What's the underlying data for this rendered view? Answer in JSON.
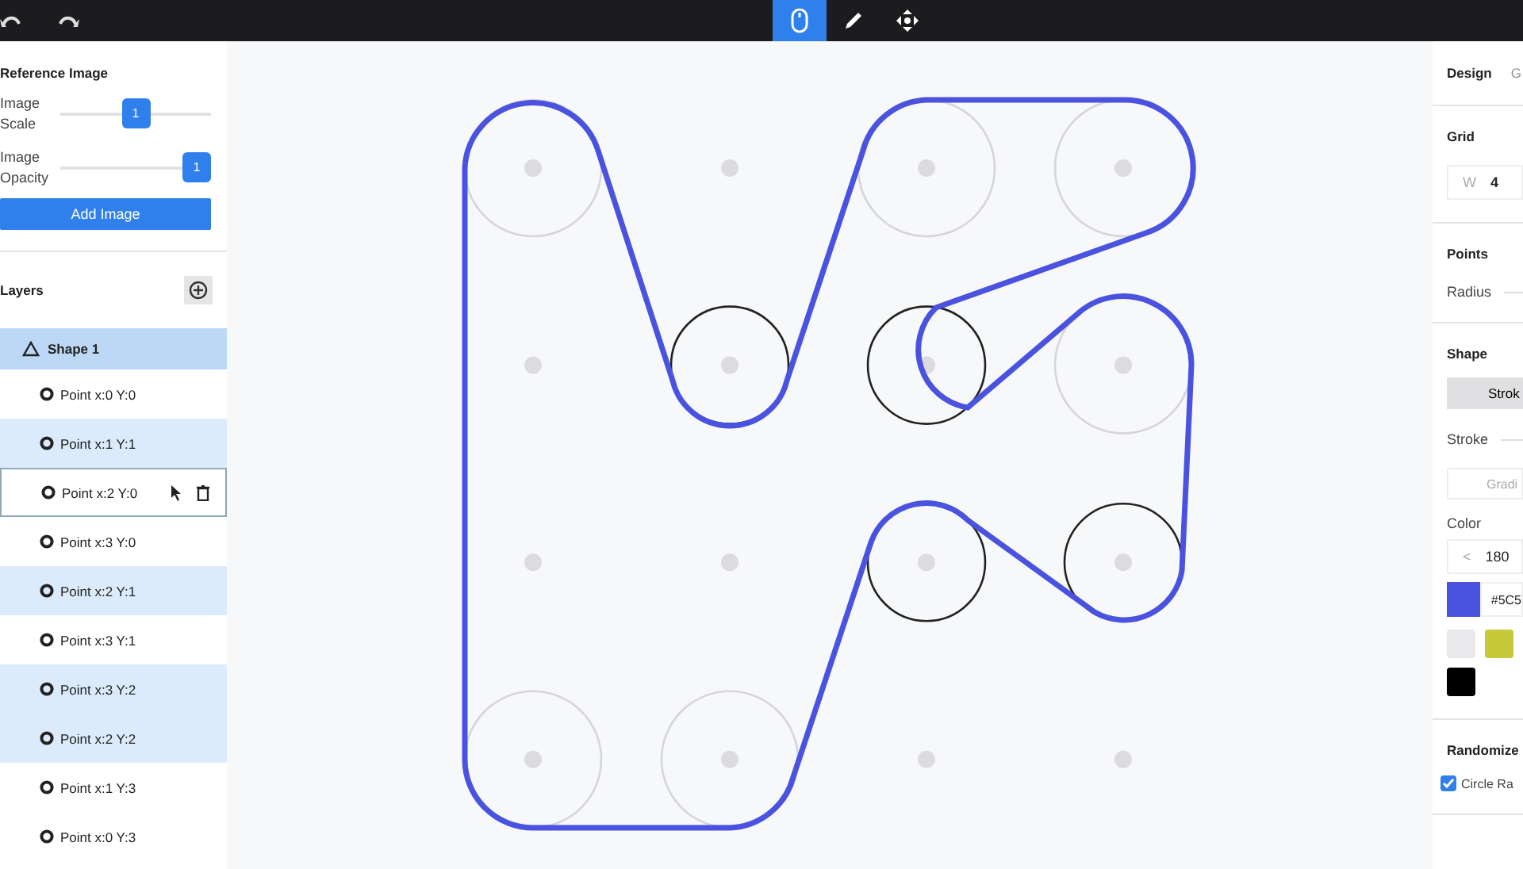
{
  "toolbar": {
    "tools": [
      {
        "kind": "mouse",
        "selected": true
      },
      {
        "kind": "pencil",
        "selected": false
      },
      {
        "kind": "move",
        "selected": false
      }
    ]
  },
  "reference_image": {
    "title": "Reference Image",
    "sliders": [
      {
        "label": "Image Scale",
        "value": "1",
        "level": 0.5
      },
      {
        "label": "Image Opacity",
        "value": "1",
        "level": 1
      }
    ],
    "button": "Add Image"
  },
  "layers": {
    "title": "Layers",
    "shape": {
      "label": "Shape 1",
      "selected": true,
      "children": [
        {
          "label": "Point x:0 Y:0",
          "selected": false,
          "hovered": false
        },
        {
          "label": "Point x:1 Y:1",
          "selected": true,
          "hovered": false
        },
        {
          "label": "Point x:2 Y:0",
          "selected": false,
          "hovered": true
        },
        {
          "label": "Point x:3 Y:0",
          "selected": false,
          "hovered": false
        },
        {
          "label": "Point x:2 Y:1",
          "selected": true,
          "hovered": false
        },
        {
          "label": "Point x:3 Y:1",
          "selected": false,
          "hovered": false
        },
        {
          "label": "Point x:3 Y:2",
          "selected": true,
          "hovered": false
        },
        {
          "label": "Point x:2 Y:2",
          "selected": true,
          "hovered": false
        },
        {
          "label": "Point x:1 Y:3",
          "selected": false,
          "hovered": false
        },
        {
          "label": "Point x:0 Y:3",
          "selected": false,
          "hovered": false
        }
      ]
    }
  },
  "right_panel": {
    "tabs": [
      {
        "label": "Design",
        "selected": true
      },
      {
        "label": "G",
        "selected": false
      }
    ],
    "grid": {
      "title": "Grid",
      "w_label": "W",
      "w_value": "4"
    },
    "points": {
      "title": "Points",
      "radius_label": "Radius"
    },
    "shape": {
      "title": "Shape",
      "mode_button": "Strok",
      "stroke_label": "Stroke",
      "gradient_button": "Gradi",
      "color_label": "Color",
      "angle_arrow": "<",
      "angle": "180",
      "color": "#4a52e0",
      "hex": "#5C5",
      "swatches": [
        {
          "color": "#e9e9eb"
        },
        {
          "color": "#c6c93a"
        },
        {
          "color": "#000000"
        }
      ]
    },
    "randomize": {
      "title": "Randomize",
      "option": "Circle Ra",
      "checked": true
    }
  }
}
